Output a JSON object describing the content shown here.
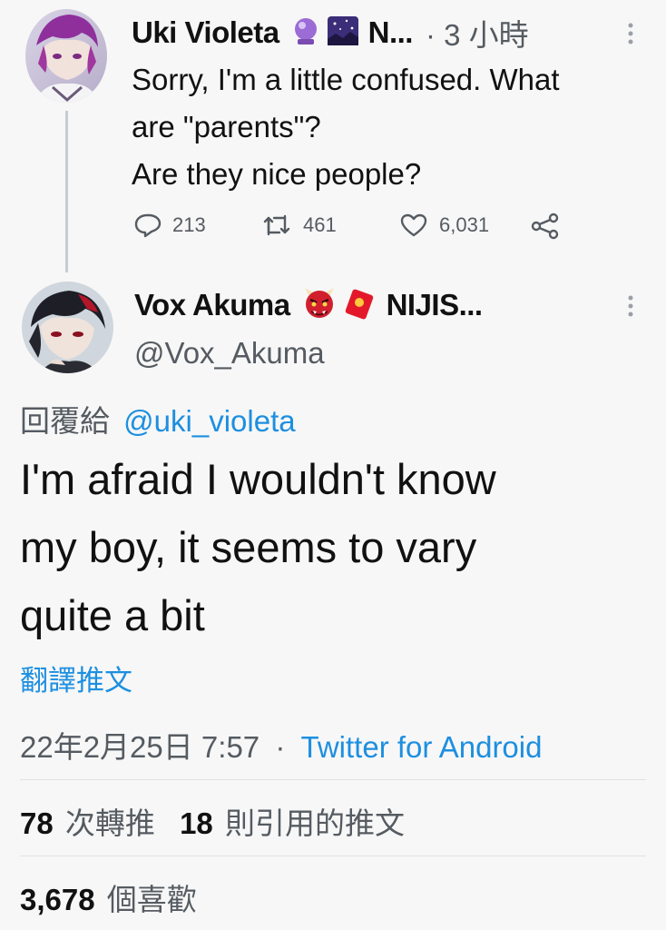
{
  "reply_tweet": {
    "author_name": "Uki Violeta",
    "author_name_tail": "N...",
    "time_ago": "· 3 小時",
    "text_line1": "Sorry, I'm a little confused. What",
    "text_line2": "are \"parents\"?",
    "text_line3": "Are they nice people?",
    "replies": "213",
    "retweets": "461",
    "likes": "6,031"
  },
  "main_tweet": {
    "author_name": "Vox Akuma",
    "author_name_tail": "NIJIS...",
    "handle": "@Vox_Akuma",
    "reply_to_prefix": "回覆給",
    "reply_to_handle": "@uki_violeta",
    "text_line1": "I'm afraid I wouldn't know",
    "text_line2": "my boy, it seems to vary",
    "text_line3": "quite a bit",
    "translate_label": "翻譯推文",
    "timestamp": "22年2月25日 7:57",
    "separator": "·",
    "source": "Twitter for Android",
    "retweet_count": "78",
    "retweet_label": "次轉推",
    "quote_count": "18",
    "quote_label": "則引用的推文",
    "like_count": "3,678",
    "like_label": "個喜歡"
  },
  "icons": {
    "reply": "reply-icon",
    "retweet": "retweet-icon",
    "like": "heart-icon",
    "share": "share-icon",
    "more": "more-vertical-icon"
  },
  "colors": {
    "link": "#1d8fe0",
    "muted": "#555b61",
    "thread_line": "#c8ccd0"
  }
}
